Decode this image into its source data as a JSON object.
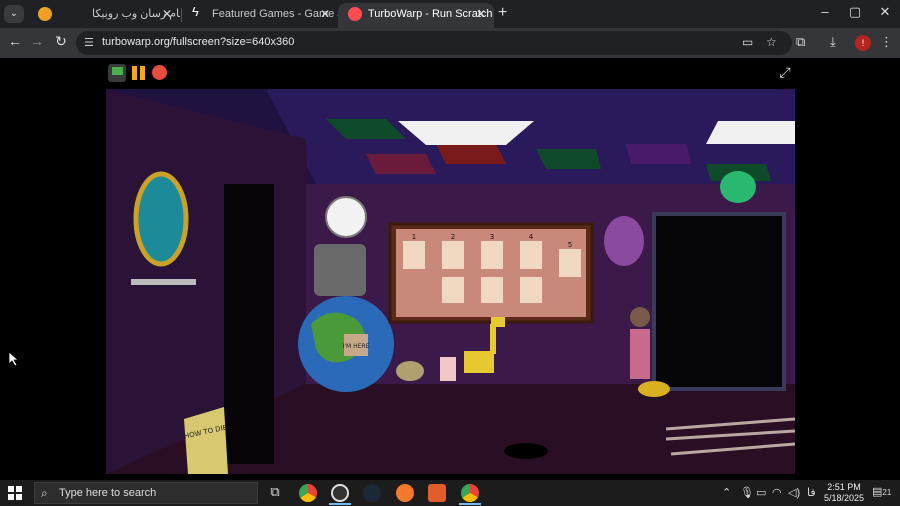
{
  "browser": {
    "tabs": [
      {
        "title": "پیام رسان وب روبیکا",
        "favicon": "rubika-icon",
        "color": "#7b2cbf"
      },
      {
        "title": "Featured Games - Game Jolt",
        "favicon": "gamejolt-icon",
        "color": "#ffffff"
      },
      {
        "title": "TurboWarp - Run Scratch proje",
        "favicon": "turbowarp-icon",
        "color": "#ff4c4c"
      }
    ],
    "new_tab_label": "+",
    "url": "turbowarp.org/fullscreen?size=640x360",
    "window_controls": {
      "minimize": "–",
      "maximize": "▢",
      "close": "✕"
    },
    "profile_initial": "!"
  },
  "player": {
    "controls": {
      "green_flag": "green-flag-icon",
      "pause": "pause-icon",
      "stop": "stop-icon",
      "fullscreen": "⤢"
    }
  },
  "game_scene": {
    "book_title": "HOW TO DIE",
    "map_label": "I'M HERE",
    "poster_numbers": [
      "1",
      "2",
      "3",
      "4",
      "5"
    ],
    "colors": {
      "wall": "#3b1a4a",
      "floor": "#2a0f24",
      "ceiling_a": "#2a1a5c",
      "ceiling_b": "#0f3a24"
    }
  },
  "taskbar": {
    "search_placeholder": "Type here to search",
    "apps": [
      "task-view-icon",
      "chrome-icon",
      "steam-alt-icon",
      "steam-icon",
      "blender-icon",
      "app-le-icon",
      "chrome-active-icon"
    ],
    "tray_language": "فا",
    "time": "2:51 PM",
    "date": "5/18/2025",
    "notification_count": "21"
  }
}
